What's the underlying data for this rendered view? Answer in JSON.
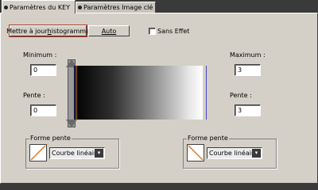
{
  "tabs": [
    {
      "label": "Paramètres du KEY",
      "active": true
    },
    {
      "label": "Paramètres Image clé",
      "active": false
    }
  ],
  "toolbar": {
    "update_histogram_label_pre": "Mettre à jour ",
    "update_histogram_label_u": "h",
    "update_histogram_label_post": "istogramme",
    "auto_label": "Auto",
    "no_effect_label": "Sans Effet",
    "no_effect_checked": false
  },
  "left": {
    "minimum_label": "Minimum :",
    "minimum_value": "0",
    "slope_label": "Pente :",
    "slope_value": "0"
  },
  "right": {
    "maximum_label": "Maximum :",
    "maximum_value": "3",
    "slope_label": "Pente :",
    "slope_value": "3"
  },
  "curve_left": {
    "title": "Forme pente",
    "selected": "Courbe linéaire"
  },
  "curve_right": {
    "title": "Forme pente",
    "selected": "Courbe linéaire"
  },
  "colors": {
    "focus": "#b0331f",
    "marker_line": "#4444cc",
    "curve_line": "#e07b1c"
  }
}
